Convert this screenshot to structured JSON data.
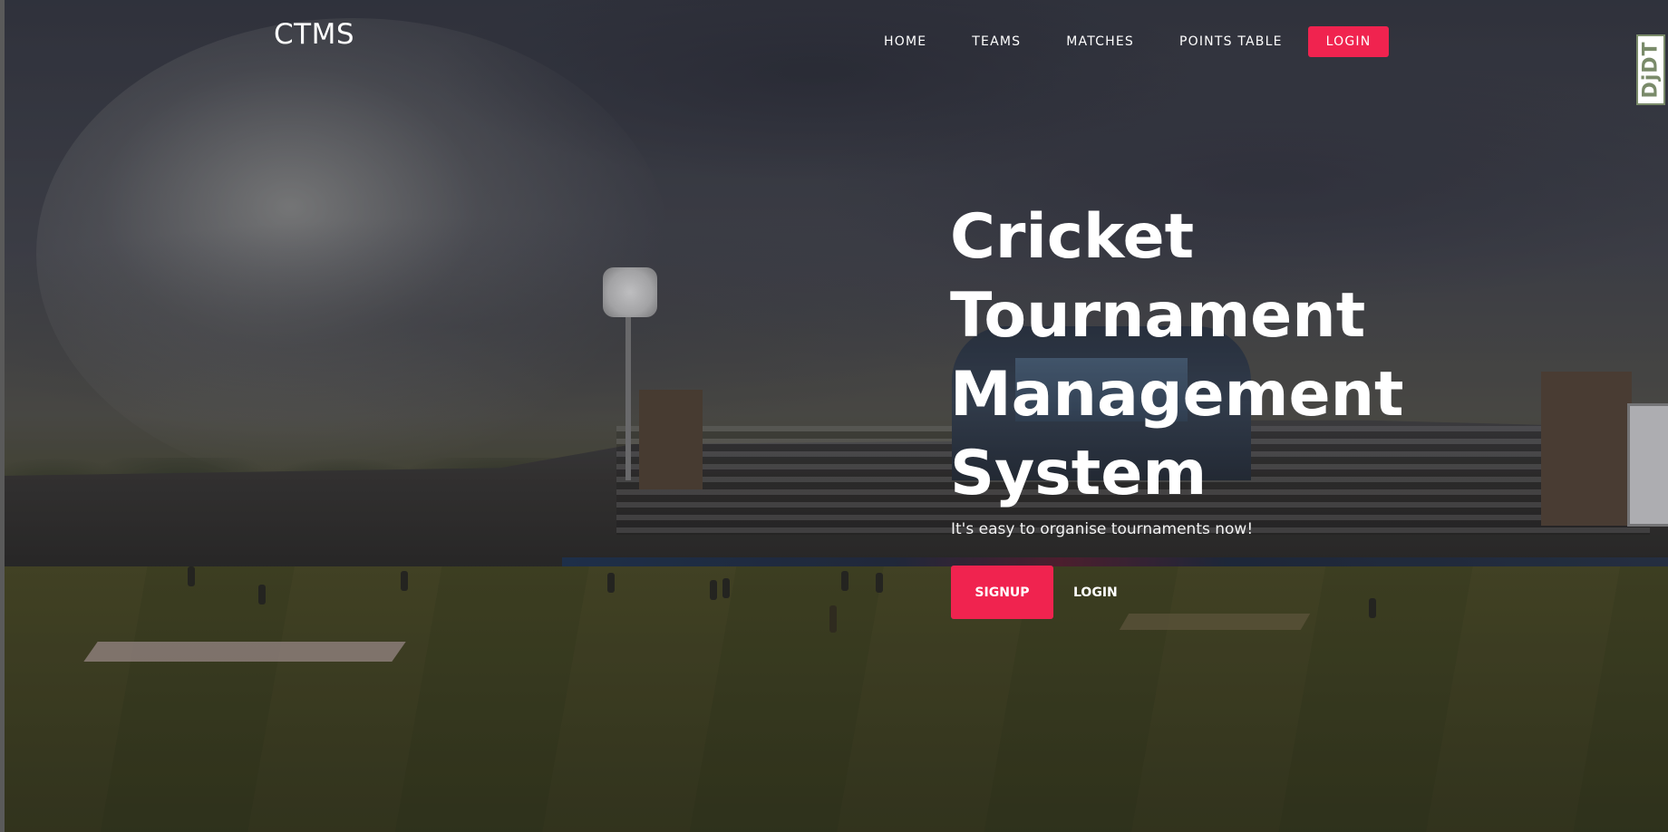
{
  "brand": {
    "name": "CTMS"
  },
  "nav": {
    "items": [
      {
        "label": "HOME"
      },
      {
        "label": "TEAMS"
      },
      {
        "label": "MATCHES"
      },
      {
        "label": "POINTS TABLE"
      }
    ],
    "login_label": "LOGIN"
  },
  "hero": {
    "title_lines": [
      "Cricket",
      "Tournament",
      "Management",
      "System"
    ],
    "subtitle": "It's easy to organise tournaments now!",
    "signup_label": "SIGNUP",
    "login_label": "LOGIN",
    "background_image": "cricket-stadium-photo"
  },
  "debug_toolbar": {
    "label": "DjDT"
  },
  "colors": {
    "accent": "#f0234f",
    "text": "#ffffff"
  }
}
